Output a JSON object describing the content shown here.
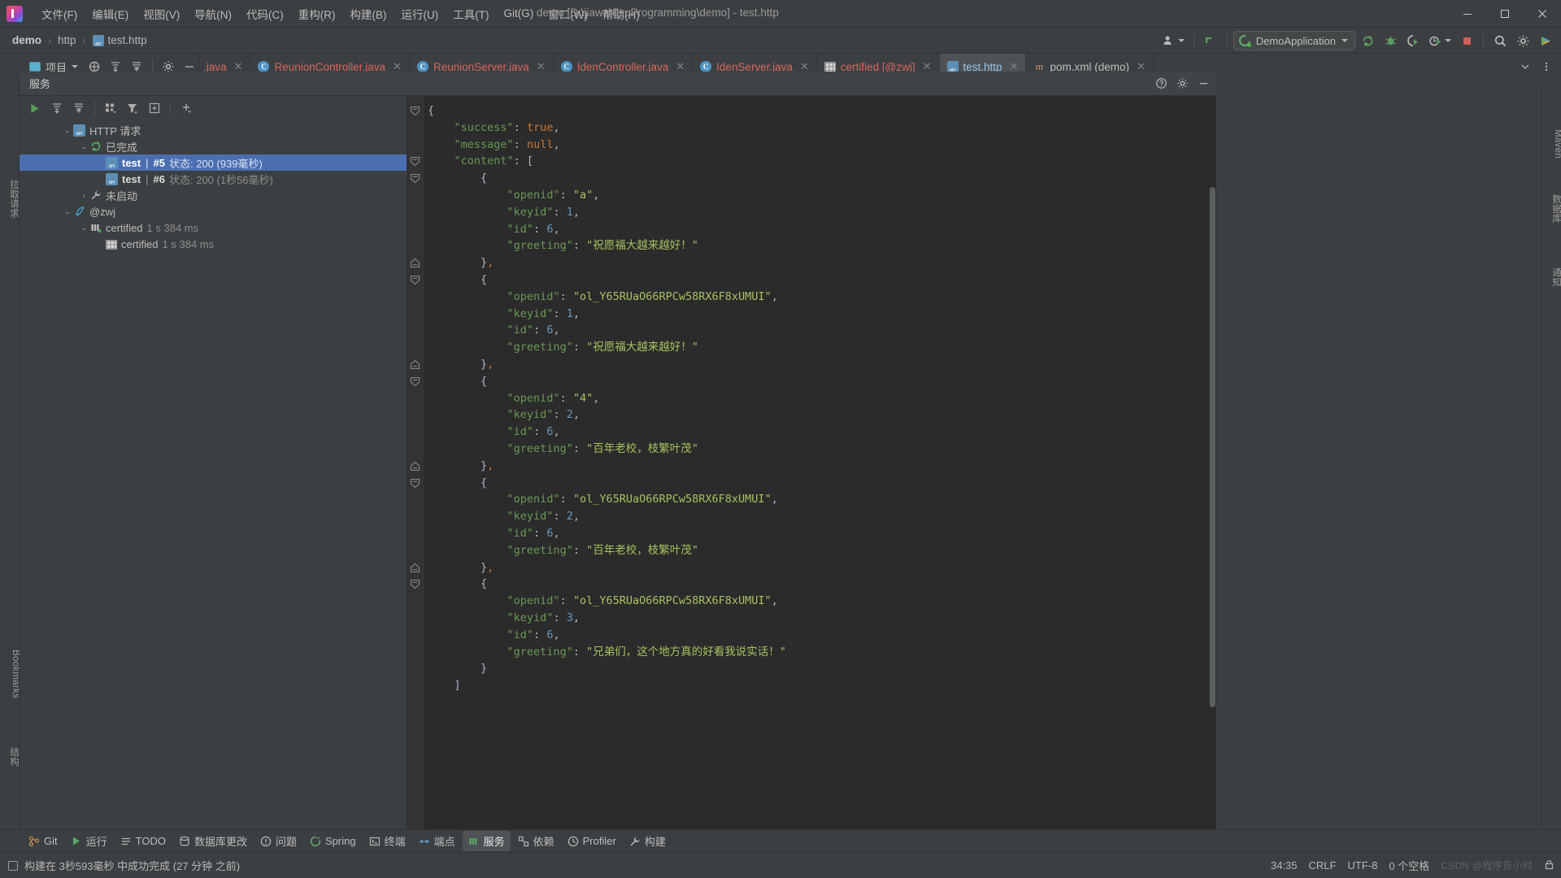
{
  "window": {
    "title": "demo [D:\\jiawa\\FzuProgramming\\demo] - test.http",
    "minimize": "—",
    "maximize": "❐",
    "close": "✕"
  },
  "menu": [
    {
      "label": "文件(F)"
    },
    {
      "label": "编辑(E)"
    },
    {
      "label": "视图(V)"
    },
    {
      "label": "导航(N)"
    },
    {
      "label": "代码(C)"
    },
    {
      "label": "重构(R)"
    },
    {
      "label": "构建(B)"
    },
    {
      "label": "运行(U)"
    },
    {
      "label": "工具(T)"
    },
    {
      "label": "Git(G)"
    },
    {
      "label": "窗口(W)"
    },
    {
      "label": "帮助(H)"
    }
  ],
  "breadcrumb": {
    "project": "demo",
    "folder": "http",
    "file": "test.http",
    "sep": "›"
  },
  "toolbar": {
    "run_config": "DemoApplication",
    "run_tooltip": "▶",
    "rerun": "↻",
    "debug": "🐞",
    "coverage": "◐",
    "profiler": "⏱",
    "stop": "■",
    "search": "🔍",
    "settings": "⚙",
    "user": "👤",
    "updates": "↖"
  },
  "project_button": {
    "label": "项目"
  },
  "tabs": [
    {
      "label": ".java",
      "icon": "java-icon",
      "active": false,
      "partial": true
    },
    {
      "label": "ReunionController.java",
      "icon": "class-icon",
      "glyph": "C",
      "active": false
    },
    {
      "label": "ReunionServer.java",
      "icon": "class-icon",
      "glyph": "C",
      "active": false
    },
    {
      "label": "IdenController.java",
      "icon": "class-icon",
      "glyph": "C",
      "active": false
    },
    {
      "label": "IdenServer.java",
      "icon": "class-icon",
      "glyph": "C",
      "active": false
    },
    {
      "label": "certified [@zwj]",
      "icon": "table-icon",
      "active": false
    },
    {
      "label": "test.http",
      "icon": "http-icon",
      "active": true
    },
    {
      "label": "pom.xml (demo)",
      "icon": "maven-icon",
      "glyph": "m",
      "active": false
    }
  ],
  "services": {
    "header_title": "服务",
    "tree": [
      {
        "indent": 0,
        "twisty": "⌄",
        "icon": "http-api-icon",
        "label": "HTTP 请求",
        "bold": false,
        "meta": "",
        "selected": false
      },
      {
        "indent": 1,
        "twisty": "⌄",
        "icon": "run-icon",
        "label": "已完成",
        "bold": false,
        "meta": "",
        "selected": false
      },
      {
        "indent": 2,
        "twisty": "",
        "icon": "http-api-icon",
        "label": "test",
        "bold": true,
        "bar": "|",
        "num": "#5",
        "meta": "状态: 200 (939毫秒)",
        "selected": true
      },
      {
        "indent": 2,
        "twisty": "",
        "icon": "http-api-icon",
        "label": "test",
        "bold": true,
        "bar": "|",
        "num": "#6",
        "meta": "状态: 200 (1秒56毫秒)",
        "selected": false
      },
      {
        "indent": 1,
        "twisty": "›",
        "icon": "wrench-icon",
        "label": "未启动",
        "bold": false,
        "meta": "",
        "selected": false
      },
      {
        "indent": 0,
        "twisty": "⌄",
        "icon": "datagrip-icon",
        "label": "@zwj",
        "bold": false,
        "meta": "",
        "selected": false
      },
      {
        "indent": 1,
        "twisty": "⌄",
        "icon": "server-icon",
        "label": "certified",
        "bold": false,
        "meta": "1 s 384 ms",
        "selected": false
      },
      {
        "indent": 2,
        "twisty": "",
        "icon": "table-icon",
        "label": "certified",
        "bold": false,
        "meta": "1 s 384 ms",
        "selected": false
      }
    ]
  },
  "response": {
    "lines": [
      {
        "fold": "minus",
        "parts": [
          {
            "t": "{",
            "c": "p"
          }
        ],
        "indent": 0
      },
      {
        "fold": "",
        "parts": [
          {
            "t": "\"success\"",
            "c": "k"
          },
          {
            "t": ": ",
            "c": "p"
          },
          {
            "t": "true",
            "c": "kw"
          },
          {
            "t": ",",
            "c": "p"
          }
        ],
        "indent": 1
      },
      {
        "fold": "",
        "parts": [
          {
            "t": "\"message\"",
            "c": "k"
          },
          {
            "t": ": ",
            "c": "p"
          },
          {
            "t": "null",
            "c": "kw"
          },
          {
            "t": ",",
            "c": "p"
          }
        ],
        "indent": 1
      },
      {
        "fold": "minus",
        "parts": [
          {
            "t": "\"content\"",
            "c": "k"
          },
          {
            "t": ": [",
            "c": "p"
          }
        ],
        "indent": 1
      },
      {
        "fold": "minus",
        "parts": [
          {
            "t": "{",
            "c": "p"
          }
        ],
        "indent": 2
      },
      {
        "fold": "",
        "parts": [
          {
            "t": "\"openid\"",
            "c": "k"
          },
          {
            "t": ": ",
            "c": "p"
          },
          {
            "t": "\"a\"",
            "c": "s"
          },
          {
            "t": ",",
            "c": "p"
          }
        ],
        "indent": 3
      },
      {
        "fold": "",
        "parts": [
          {
            "t": "\"keyid\"",
            "c": "k"
          },
          {
            "t": ": ",
            "c": "p"
          },
          {
            "t": "1",
            "c": "n"
          },
          {
            "t": ",",
            "c": "p"
          }
        ],
        "indent": 3
      },
      {
        "fold": "",
        "parts": [
          {
            "t": "\"id\"",
            "c": "k"
          },
          {
            "t": ": ",
            "c": "p"
          },
          {
            "t": "6",
            "c": "n"
          },
          {
            "t": ",",
            "c": "p"
          }
        ],
        "indent": 3
      },
      {
        "fold": "",
        "parts": [
          {
            "t": "\"greeting\"",
            "c": "k"
          },
          {
            "t": ": ",
            "c": "p"
          },
          {
            "t": "\"祝愿福大越来越好！\"",
            "c": "s"
          }
        ],
        "indent": 3
      },
      {
        "fold": "plus",
        "parts": [
          {
            "t": "}",
            "c": "p"
          },
          {
            "t": ",",
            "c": "com"
          }
        ],
        "indent": 2
      },
      {
        "fold": "minus",
        "parts": [
          {
            "t": "{",
            "c": "p"
          }
        ],
        "indent": 2
      },
      {
        "fold": "",
        "parts": [
          {
            "t": "\"openid\"",
            "c": "k"
          },
          {
            "t": ": ",
            "c": "p"
          },
          {
            "t": "\"ol_Y65RUaO66RPCw58RX6F8xUMUI\"",
            "c": "s"
          },
          {
            "t": ",",
            "c": "p"
          }
        ],
        "indent": 3
      },
      {
        "fold": "",
        "parts": [
          {
            "t": "\"keyid\"",
            "c": "k"
          },
          {
            "t": ": ",
            "c": "p"
          },
          {
            "t": "1",
            "c": "n"
          },
          {
            "t": ",",
            "c": "p"
          }
        ],
        "indent": 3
      },
      {
        "fold": "",
        "parts": [
          {
            "t": "\"id\"",
            "c": "k"
          },
          {
            "t": ": ",
            "c": "p"
          },
          {
            "t": "6",
            "c": "n"
          },
          {
            "t": ",",
            "c": "p"
          }
        ],
        "indent": 3
      },
      {
        "fold": "",
        "parts": [
          {
            "t": "\"greeting\"",
            "c": "k"
          },
          {
            "t": ": ",
            "c": "p"
          },
          {
            "t": "\"祝愿福大越来越好！\"",
            "c": "s"
          }
        ],
        "indent": 3
      },
      {
        "fold": "plus",
        "parts": [
          {
            "t": "}",
            "c": "p"
          },
          {
            "t": ",",
            "c": "com"
          }
        ],
        "indent": 2
      },
      {
        "fold": "minus",
        "parts": [
          {
            "t": "{",
            "c": "p"
          }
        ],
        "indent": 2
      },
      {
        "fold": "",
        "parts": [
          {
            "t": "\"openid\"",
            "c": "k"
          },
          {
            "t": ": ",
            "c": "p"
          },
          {
            "t": "\"4\"",
            "c": "s"
          },
          {
            "t": ",",
            "c": "p"
          }
        ],
        "indent": 3
      },
      {
        "fold": "",
        "parts": [
          {
            "t": "\"keyid\"",
            "c": "k"
          },
          {
            "t": ": ",
            "c": "p"
          },
          {
            "t": "2",
            "c": "n"
          },
          {
            "t": ",",
            "c": "p"
          }
        ],
        "indent": 3
      },
      {
        "fold": "",
        "parts": [
          {
            "t": "\"id\"",
            "c": "k"
          },
          {
            "t": ": ",
            "c": "p"
          },
          {
            "t": "6",
            "c": "n"
          },
          {
            "t": ",",
            "c": "p"
          }
        ],
        "indent": 3
      },
      {
        "fold": "",
        "parts": [
          {
            "t": "\"greeting\"",
            "c": "k"
          },
          {
            "t": ": ",
            "c": "p"
          },
          {
            "t": "\"百年老校，枝繁叶茂\"",
            "c": "s"
          }
        ],
        "indent": 3
      },
      {
        "fold": "plus",
        "parts": [
          {
            "t": "}",
            "c": "p"
          },
          {
            "t": ",",
            "c": "com"
          }
        ],
        "indent": 2
      },
      {
        "fold": "minus",
        "parts": [
          {
            "t": "{",
            "c": "p"
          }
        ],
        "indent": 2
      },
      {
        "fold": "",
        "parts": [
          {
            "t": "\"openid\"",
            "c": "k"
          },
          {
            "t": ": ",
            "c": "p"
          },
          {
            "t": "\"ol_Y65RUaO66RPCw58RX6F8xUMUI\"",
            "c": "s"
          },
          {
            "t": ",",
            "c": "p"
          }
        ],
        "indent": 3
      },
      {
        "fold": "",
        "parts": [
          {
            "t": "\"keyid\"",
            "c": "k"
          },
          {
            "t": ": ",
            "c": "p"
          },
          {
            "t": "2",
            "c": "n"
          },
          {
            "t": ",",
            "c": "p"
          }
        ],
        "indent": 3
      },
      {
        "fold": "",
        "parts": [
          {
            "t": "\"id\"",
            "c": "k"
          },
          {
            "t": ": ",
            "c": "p"
          },
          {
            "t": "6",
            "c": "n"
          },
          {
            "t": ",",
            "c": "p"
          }
        ],
        "indent": 3
      },
      {
        "fold": "",
        "parts": [
          {
            "t": "\"greeting\"",
            "c": "k"
          },
          {
            "t": ": ",
            "c": "p"
          },
          {
            "t": "\"百年老校，枝繁叶茂\"",
            "c": "s"
          }
        ],
        "indent": 3
      },
      {
        "fold": "plus",
        "parts": [
          {
            "t": "}",
            "c": "p"
          },
          {
            "t": ",",
            "c": "com"
          }
        ],
        "indent": 2
      },
      {
        "fold": "minus",
        "parts": [
          {
            "t": "{",
            "c": "p"
          }
        ],
        "indent": 2
      },
      {
        "fold": "",
        "parts": [
          {
            "t": "\"openid\"",
            "c": "k"
          },
          {
            "t": ": ",
            "c": "p"
          },
          {
            "t": "\"ol_Y65RUaO66RPCw58RX6F8xUMUI\"",
            "c": "s"
          },
          {
            "t": ",",
            "c": "p"
          }
        ],
        "indent": 3
      },
      {
        "fold": "",
        "parts": [
          {
            "t": "\"keyid\"",
            "c": "k"
          },
          {
            "t": ": ",
            "c": "p"
          },
          {
            "t": "3",
            "c": "n"
          },
          {
            "t": ",",
            "c": "p"
          }
        ],
        "indent": 3
      },
      {
        "fold": "",
        "parts": [
          {
            "t": "\"id\"",
            "c": "k"
          },
          {
            "t": ": ",
            "c": "p"
          },
          {
            "t": "6",
            "c": "n"
          },
          {
            "t": ",",
            "c": "p"
          }
        ],
        "indent": 3
      },
      {
        "fold": "",
        "parts": [
          {
            "t": "\"greeting\"",
            "c": "k"
          },
          {
            "t": ": ",
            "c": "p"
          },
          {
            "t": "\"兄弟们，这个地方真的好看我说实话！\"",
            "c": "s"
          }
        ],
        "indent": 3
      },
      {
        "fold": "",
        "parts": [
          {
            "t": "}",
            "c": "p"
          }
        ],
        "indent": 2
      },
      {
        "fold": "",
        "parts": [
          {
            "t": "]",
            "c": "p"
          }
        ],
        "indent": 1
      }
    ]
  },
  "left_rail": [
    {
      "label": "拉取请求",
      "name": "pull-requests"
    },
    {
      "label": "Bookmarks",
      "name": "bookmarks"
    },
    {
      "label": "结构",
      "name": "structure"
    }
  ],
  "right_rail": [
    {
      "label": "Maven",
      "name": "maven"
    },
    {
      "label": "数据库",
      "name": "database"
    },
    {
      "label": "通知",
      "name": "notifications"
    }
  ],
  "bottom_tools": [
    {
      "label": "Git",
      "icon": "git-icon",
      "active": false
    },
    {
      "label": "运行",
      "icon": "run-icon",
      "active": false
    },
    {
      "label": "TODO",
      "icon": "todo-icon",
      "active": false
    },
    {
      "label": "数据库更改",
      "icon": "db-changes-icon",
      "active": false
    },
    {
      "label": "问题",
      "icon": "problems-icon",
      "active": false
    },
    {
      "label": "Spring",
      "icon": "spring-icon",
      "active": false
    },
    {
      "label": "终端",
      "icon": "terminal-icon",
      "active": false
    },
    {
      "label": "端点",
      "icon": "endpoints-icon",
      "active": false
    },
    {
      "label": "服务",
      "icon": "services-icon",
      "active": true
    },
    {
      "label": "依赖",
      "icon": "dependencies-icon",
      "active": false
    },
    {
      "label": "Profiler",
      "icon": "profiler-icon",
      "active": false
    },
    {
      "label": "构建",
      "icon": "build-icon",
      "active": false
    }
  ],
  "status": {
    "message": "构建在 3秒593毫秒 中成功完成 (27 分钟 之前)",
    "caret": "34:35",
    "line_sep": "CRLF",
    "encoding": "UTF-8",
    "indent": "0 个空格",
    "watermark": "CSDN @程序员小时"
  }
}
